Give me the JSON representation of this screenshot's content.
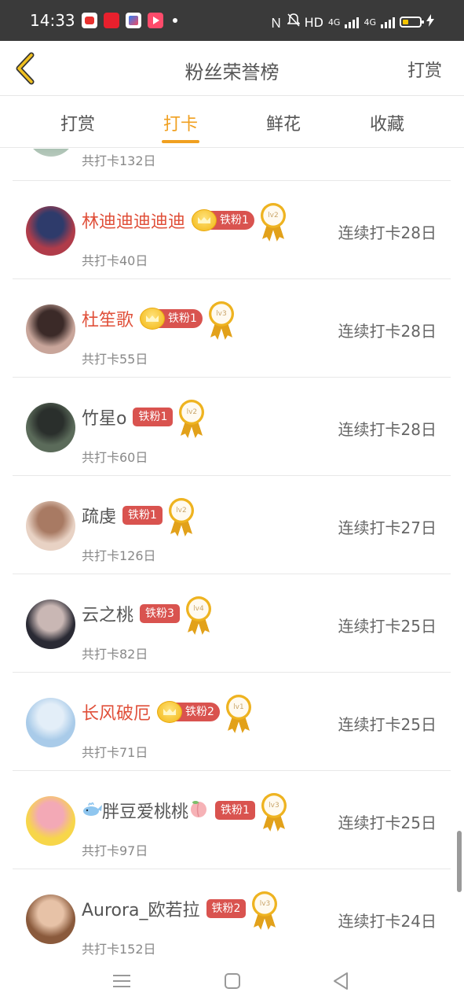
{
  "status_bar": {
    "time": "14:33",
    "network_label": "HD",
    "signal_1": "4G",
    "signal_2": "4G"
  },
  "header": {
    "title": "粉丝荣誉榜",
    "action": "打赏"
  },
  "tabs": [
    {
      "label": "打赏",
      "active": false
    },
    {
      "label": "打卡",
      "active": true
    },
    {
      "label": "鲜花",
      "active": false
    },
    {
      "label": "收藏",
      "active": false
    }
  ],
  "list": {
    "partial_row": {
      "total": "共打卡132日"
    },
    "rows": [
      {
        "name": "林迪迪迪迪迪",
        "vip": true,
        "fan_badge": "铁粉1",
        "level": "lv2",
        "total": "共打卡40日",
        "streak": "连续打卡28日",
        "avatar_colors": [
          "#b03c4a",
          "#2e3b6b"
        ]
      },
      {
        "name": "杜笙歌",
        "vip": true,
        "fan_badge": "铁粉1",
        "level": "lv3",
        "total": "共打卡55日",
        "streak": "连续打卡28日",
        "avatar_colors": [
          "#c8a59a",
          "#3b2a28"
        ]
      },
      {
        "name": "竹星o",
        "vip": false,
        "fan_badge": "铁粉1",
        "level": "lv2",
        "total": "共打卡60日",
        "streak": "连续打卡28日",
        "avatar_colors": [
          "#5b6b5a",
          "#2a2f2c"
        ]
      },
      {
        "name": "疏虔",
        "vip": false,
        "fan_badge": "铁粉1",
        "level": "lv2",
        "total": "共打卡126日",
        "streak": "连续打卡27日",
        "avatar_colors": [
          "#e8d2c4",
          "#a87a63"
        ]
      },
      {
        "name": "云之桃",
        "vip": false,
        "fan_badge": "铁粉3",
        "level": "lv4",
        "total": "共打卡82日",
        "streak": "连续打卡25日",
        "avatar_colors": [
          "#2a2a34",
          "#c9b7b4"
        ]
      },
      {
        "name": "长风破厄",
        "vip": true,
        "fan_badge": "铁粉2",
        "level": "lv1",
        "total": "共打卡71日",
        "streak": "连续打卡25日",
        "avatar_colors": [
          "#a9cbe9",
          "#e3eef8"
        ]
      },
      {
        "name": "胖豆爱桃桃",
        "vip": false,
        "fan_badge": "铁粉1",
        "level": "lv3",
        "total": "共打卡97日",
        "streak": "连续打卡25日",
        "avatar_colors": [
          "#f7d64a",
          "#f3a9b6"
        ],
        "emoji_before": "whale-emoji",
        "emoji_after": "peach-emoji"
      },
      {
        "name": "Aurora_欧若拉",
        "vip": false,
        "fan_badge": "铁粉2",
        "level": "lv3",
        "total": "共打卡152日",
        "streak": "连续打卡24日",
        "avatar_colors": [
          "#8a5a3c",
          "#e7c2a7"
        ]
      }
    ]
  },
  "colors": {
    "accent": "#f0a020",
    "vip_name": "#e0503a",
    "fan_badge": "#d9534f"
  }
}
